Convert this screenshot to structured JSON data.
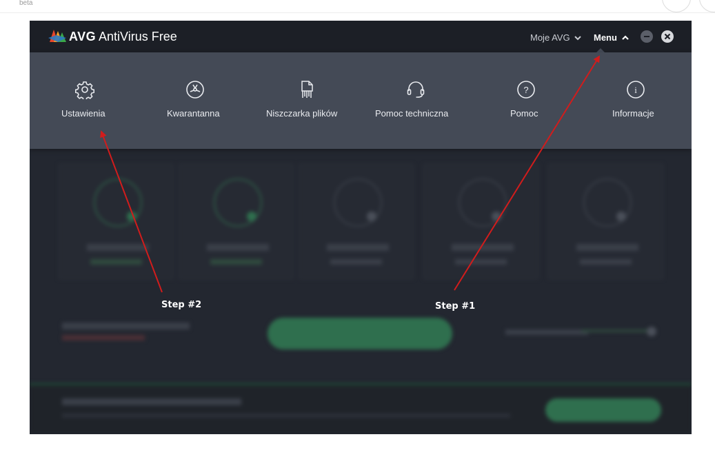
{
  "page": {
    "beta_label": "beta"
  },
  "app": {
    "brand": "AVG",
    "product": "AntiVirus Free",
    "header": {
      "my_avg_label": "Moje AVG",
      "menu_label": "Menu"
    },
    "menu_items": [
      {
        "label": "Ustawienia",
        "icon": "gear-icon"
      },
      {
        "label": "Kwarantanna",
        "icon": "quarantine-icon"
      },
      {
        "label": "Niszczarka plików",
        "icon": "shredder-icon"
      },
      {
        "label": "Pomoc techniczna",
        "icon": "headset-icon"
      },
      {
        "label": "Pomoc",
        "icon": "help-icon"
      },
      {
        "label": "Informacje",
        "icon": "info-icon"
      }
    ]
  },
  "annotations": {
    "step1": "Step #1",
    "step2": "Step #2"
  },
  "colors": {
    "titlebar": "#1c1f26",
    "dropdown": "#444a56",
    "app_bg": "#232730",
    "arrow": "#d21c1c",
    "accent_green": "#2f6f4e"
  }
}
